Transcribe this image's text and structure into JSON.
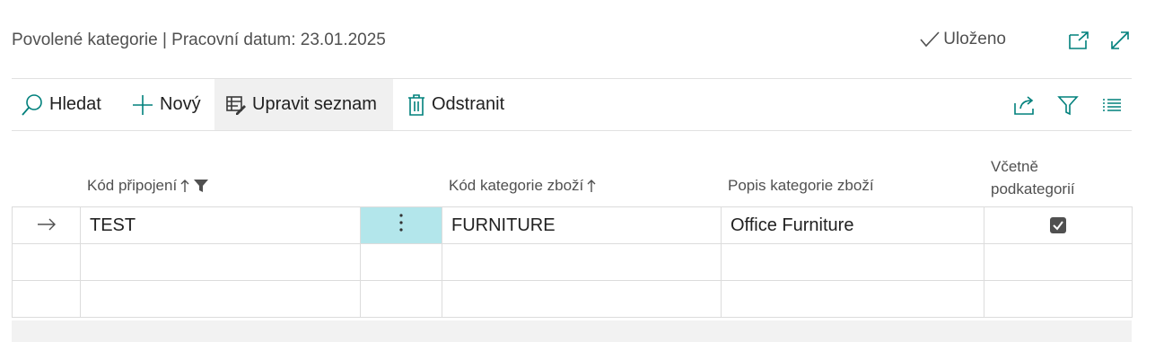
{
  "header": {
    "title": "Povolené kategorie | Pracovní datum: 23.01.2025",
    "saved_label": "Uloženo"
  },
  "actions": {
    "search": "Hledat",
    "new": "Nový",
    "edit_list": "Upravit seznam",
    "delete": "Odstranit"
  },
  "columns": {
    "connection_code": "Kód připojení",
    "category_code": "Kód kategorie zboží",
    "category_desc": "Popis kategorie zboží",
    "include_sub_line1": "Včetně",
    "include_sub_line2": "podkategorií"
  },
  "rows": [
    {
      "connection_code": "TEST",
      "category_code": "FURNITURE",
      "category_desc": "Office Furniture",
      "include_subcategories": true
    },
    {
      "connection_code": "",
      "category_code": "",
      "category_desc": "",
      "include_subcategories": false
    },
    {
      "connection_code": "",
      "category_code": "",
      "category_desc": "",
      "include_subcategories": false
    }
  ],
  "icons": {
    "saved": "checkmark-icon",
    "open_new": "open-in-new-window-icon",
    "expand": "expand-icon",
    "search": "search-icon",
    "new": "plus-icon",
    "edit_list": "edit-list-icon",
    "delete": "trash-icon",
    "share": "share-icon",
    "filter": "filter-icon",
    "list": "list-icon",
    "row_arrow": "arrow-right-icon",
    "row_menu": "more-vertical-icon"
  },
  "colors": {
    "accent": "#00807c",
    "selected_cell": "#b3e6eb"
  }
}
